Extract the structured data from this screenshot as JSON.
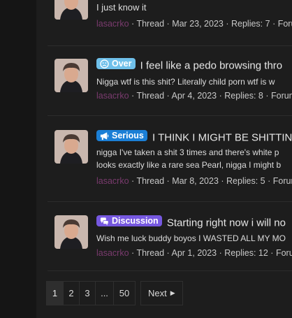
{
  "results": [
    {
      "title_text": "",
      "snippet_line1": "I just know it",
      "snippet_line2": "",
      "label": null,
      "meta": {
        "user": "lasacrko",
        "type": "Thread",
        "date": "Mar 23, 2023",
        "replies": "Replies: 7",
        "forum": "Forum:"
      }
    },
    {
      "title_text": "I feel like a pedo browsing thro",
      "snippet_line1": "Nigga wtf is this shit? Literally child porn wtf is w",
      "snippet_line2": "",
      "label": {
        "text": "Over",
        "color": "#6fc0ea",
        "icon": "sad-face-icon"
      },
      "meta": {
        "user": "lasacrko",
        "type": "Thread",
        "date": "Apr 4, 2023",
        "replies": "Replies: 8",
        "forum": "Forum"
      }
    },
    {
      "title_text": "I THINK I MIGHT BE SHITTIN",
      "snippet_line1": "nigga I've taken a shit 3 times and there's white p",
      "snippet_line2": "looks exactly like a rare sea Pearl, nigga I might b",
      "label": {
        "text": "Serious",
        "color": "#1b7fd6",
        "icon": "megaphone-icon"
      },
      "meta": {
        "user": "lasacrko",
        "type": "Thread",
        "date": "Mar 8, 2023",
        "replies": "Replies: 5",
        "forum": "Forum"
      }
    },
    {
      "title_text": "Starting right now i will no",
      "snippet_line1": "Wish me luck buddy boyos I WASTED ALL MY MO",
      "snippet_line2": "",
      "label": {
        "text": "Discussion",
        "color": "#7658e0",
        "icon": "chat-bubbles-icon"
      },
      "meta": {
        "user": "lasacrko",
        "type": "Thread",
        "date": "Apr 1, 2023",
        "replies": "Replies: 12",
        "forum": "Forum"
      }
    }
  ],
  "pagination": {
    "pages": [
      "1",
      "2",
      "3",
      "...",
      "50"
    ],
    "current": "1",
    "next_label": "Next"
  }
}
